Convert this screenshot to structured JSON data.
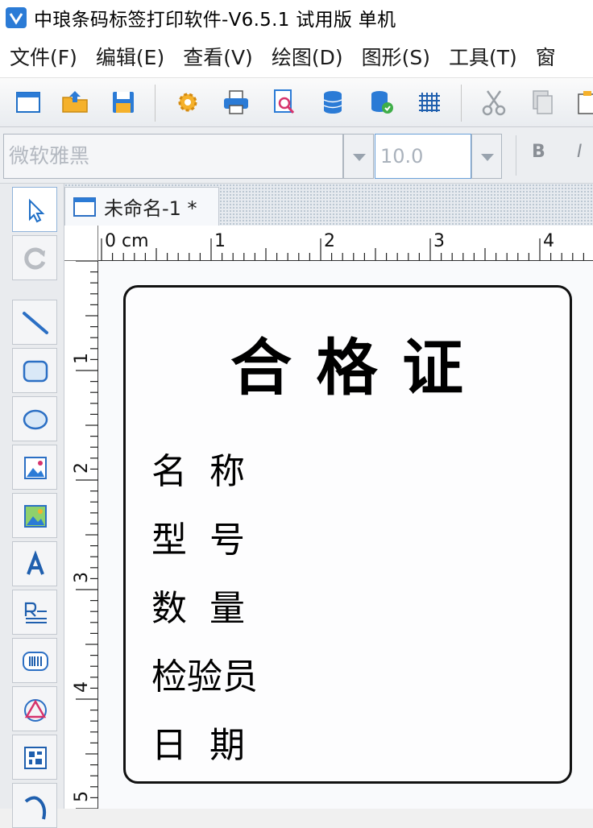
{
  "window": {
    "title": "中琅条码标签打印软件-V6.5.1 试用版 单机"
  },
  "menu": [
    "文件(F)",
    "编辑(E)",
    "查看(V)",
    "绘图(D)",
    "图形(S)",
    "工具(T)",
    "窗"
  ],
  "toolbar": {
    "icons": [
      "new-document-icon",
      "open-folder-icon",
      "save-icon",
      "settings-gear-icon",
      "print-icon",
      "print-preview-icon",
      "database-icon",
      "database-settings-icon",
      "grid-icon",
      "cut-icon",
      "copy-icon",
      "paste-icon"
    ]
  },
  "fontbar": {
    "font_name": "微软雅黑",
    "font_size": "10.0",
    "bold": "B",
    "italic": "I"
  },
  "document": {
    "tab_label": "未命名-1 *"
  },
  "rulers": {
    "top_labels": [
      "0 cm",
      "1",
      "2",
      "3",
      "4"
    ],
    "left_labels": [
      "1",
      "2",
      "3",
      "4",
      "5"
    ]
  },
  "label": {
    "title": "合 格 证",
    "fields": [
      "名  称",
      "型  号",
      "数  量",
      "检验员",
      "日  期"
    ]
  },
  "colors": {
    "accent": "#2b7bd6",
    "border": "#111111"
  }
}
